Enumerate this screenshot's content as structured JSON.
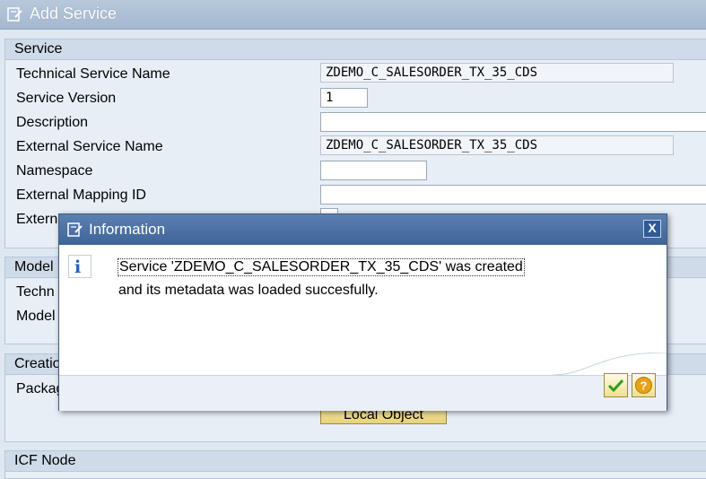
{
  "window": {
    "title": "Add Service"
  },
  "service_group": {
    "header": "Service",
    "fields": [
      {
        "label": "Technical Service Name",
        "value": "ZDEMO_C_SALESORDER_TX_35_CDS"
      },
      {
        "label": "Service Version",
        "value": "1"
      },
      {
        "label": "Description",
        "value": ""
      },
      {
        "label": "External Service Name",
        "value": "ZDEMO_C_SALESORDER_TX_35_CDS"
      },
      {
        "label": "Namespace",
        "value": ""
      },
      {
        "label": "External Mapping ID",
        "value": ""
      },
      {
        "label": "Extern",
        "value": ""
      }
    ]
  },
  "model_group": {
    "header": "Model",
    "labels": [
      "Techn",
      "Model"
    ]
  },
  "creation_group": {
    "header": "Creatio",
    "labels": [
      "Packag"
    ],
    "button_label": "Local Object"
  },
  "ice_group": {
    "header": "ICF Node"
  },
  "dialog": {
    "title": "Information",
    "close_label": "X",
    "message_line1": "Service 'ZDEMO_C_SALESORDER_TX_35_CDS' was created",
    "message_line2": "and its metadata was loaded succesfully.",
    "icon": "info-icon",
    "buttons": [
      "continue-check-icon",
      "help-question-icon"
    ]
  },
  "colors": {
    "title_bar": "#a4b8cf",
    "dialog_header": "#3f6597",
    "accent_button": "#f1df8f",
    "check_green": "#2e9c1f",
    "help_orange": "#e8a218"
  }
}
